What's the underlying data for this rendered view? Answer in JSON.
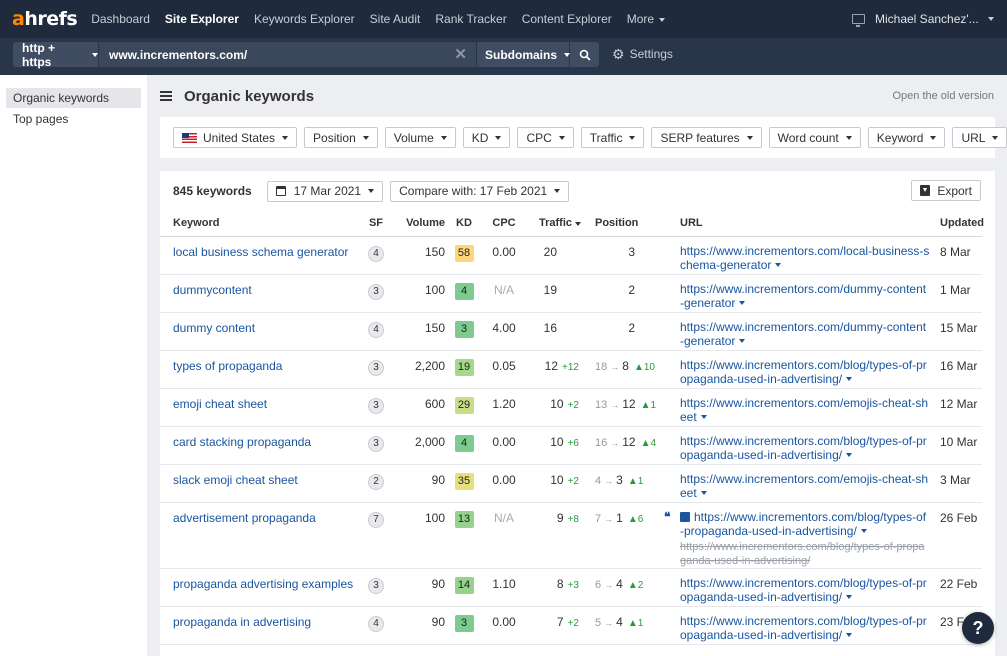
{
  "nav": {
    "logo_a": "a",
    "logo_rest": "hrefs",
    "items": [
      "Dashboard",
      "Site Explorer",
      "Keywords Explorer",
      "Site Audit",
      "Rank Tracker",
      "Content Explorer"
    ],
    "more": "More",
    "user": "Michael Sanchez'..."
  },
  "search": {
    "protocol": "http + https",
    "url": "www.incrementors.com/",
    "mode": "Subdomains",
    "settings": "Settings"
  },
  "sidebar": {
    "items": [
      "Organic keywords",
      "Top pages"
    ]
  },
  "header": {
    "title": "Organic keywords",
    "old_version": "Open the old version"
  },
  "filters": {
    "country": "United States",
    "buttons": [
      "Position",
      "Volume",
      "KD",
      "CPC",
      "Traffic",
      "SERP features",
      "Word count",
      "Keyword",
      "URL"
    ]
  },
  "summary": {
    "count": "845 keywords",
    "date": "17 Mar 2021",
    "compare": "Compare with: 17 Feb 2021",
    "export": "Export"
  },
  "table": {
    "headers": {
      "keyword": "Keyword",
      "sf": "SF",
      "volume": "Volume",
      "kd": "KD",
      "cpc": "CPC",
      "traffic": "Traffic",
      "position": "Position",
      "url": "URL",
      "updated": "Updated"
    },
    "rows": [
      {
        "keyword": "local business schema generator",
        "sf": "4",
        "volume": "150",
        "kd": "58",
        "kd_color": "#ffd77a",
        "cpc": "0.00",
        "traffic": "20",
        "traffic_delta": "",
        "pos_old": "",
        "pos": "3",
        "pos_change": "",
        "url": "https://www.incrementors.com/local-business-schema-generator",
        "url_old": "",
        "updated": "8 Mar",
        "height": 38
      },
      {
        "keyword": "dummycontent",
        "sf": "3",
        "volume": "100",
        "kd": "4",
        "kd_color": "#7ecb8f",
        "cpc": "N/A",
        "traffic": "19",
        "traffic_delta": "",
        "pos_old": "",
        "pos": "2",
        "pos_change": "",
        "url": "https://www.incrementors.com/dummy-content-generator",
        "url_old": "",
        "updated": "1 Mar",
        "height": 38
      },
      {
        "keyword": "dummy content",
        "sf": "4",
        "volume": "150",
        "kd": "3",
        "kd_color": "#7ecb8f",
        "cpc": "4.00",
        "traffic": "16",
        "traffic_delta": "",
        "pos_old": "",
        "pos": "2",
        "pos_change": "",
        "url": "https://www.incrementors.com/dummy-content-generator",
        "url_old": "",
        "updated": "15 Mar",
        "height": 38
      },
      {
        "keyword": "types of propaganda",
        "sf": "3",
        "volume": "2,200",
        "kd": "19",
        "kd_color": "#a4d98a",
        "cpc": "0.05",
        "traffic": "12",
        "traffic_delta": "+12",
        "pos_old": "18",
        "pos": "8",
        "pos_change": "▲10",
        "url": "https://www.incrementors.com/blog/types-of-propaganda-used-in-advertising/",
        "url_old": "",
        "updated": "16 Mar",
        "height": 38
      },
      {
        "keyword": "emoji cheat sheet",
        "sf": "3",
        "volume": "600",
        "kd": "29",
        "kd_color": "#c8dd86",
        "cpc": "1.20",
        "traffic": "10",
        "traffic_delta": "+2",
        "pos_old": "13",
        "pos": "12",
        "pos_change": "▲1",
        "url": "https://www.incrementors.com/emojis-cheat-sheet",
        "url_old": "",
        "updated": "12 Mar",
        "height": 38
      },
      {
        "keyword": "card stacking propaganda",
        "sf": "3",
        "volume": "2,000",
        "kd": "4",
        "kd_color": "#7ecb8f",
        "cpc": "0.00",
        "traffic": "10",
        "traffic_delta": "+6",
        "pos_old": "16",
        "pos": "12",
        "pos_change": "▲4",
        "url": "https://www.incrementors.com/blog/types-of-propaganda-used-in-advertising/",
        "url_old": "",
        "updated": "10 Mar",
        "height": 38
      },
      {
        "keyword": "slack emoji cheat sheet",
        "sf": "2",
        "volume": "90",
        "kd": "35",
        "kd_color": "#e6df7c",
        "cpc": "0.00",
        "traffic": "10",
        "traffic_delta": "+2",
        "pos_old": "4",
        "pos": "3",
        "pos_change": "▲1",
        "url": "https://www.incrementors.com/emojis-cheat-sheet",
        "url_old": "",
        "updated": "3 Mar",
        "height": 38
      },
      {
        "keyword": "advertisement propaganda",
        "sf": "7",
        "volume": "100",
        "kd": "13",
        "kd_color": "#94d38d",
        "cpc": "N/A",
        "traffic": "9",
        "traffic_delta": "+8",
        "pos_old": "7",
        "pos": "1",
        "pos_change": "▲6",
        "url": "https://www.incrementors.com/blog/types-of-propaganda-used-in-advertising/",
        "url_old": "https://www.incrementors.com/blog/types-of-propaganda-used-in-advertising/",
        "updated": "26 Feb",
        "height": 66,
        "featured": true
      },
      {
        "keyword": "propaganda advertising examples",
        "sf": "3",
        "volume": "90",
        "kd": "14",
        "kd_color": "#94d38d",
        "cpc": "1.10",
        "traffic": "8",
        "traffic_delta": "+3",
        "pos_old": "6",
        "pos": "4",
        "pos_change": "▲2",
        "url": "https://www.incrementors.com/blog/types-of-propaganda-used-in-advertising/",
        "url_old": "",
        "updated": "22 Feb",
        "height": 38
      },
      {
        "keyword": "propaganda in advertising",
        "sf": "4",
        "volume": "90",
        "kd": "3",
        "kd_color": "#7ecb8f",
        "cpc": "0.00",
        "traffic": "7",
        "traffic_delta": "+2",
        "pos_old": "5",
        "pos": "4",
        "pos_change": "▲1",
        "url": "https://www.incrementors.com/blog/types-of-propaganda-used-in-advertising/",
        "url_old": "",
        "updated": "23 Feb",
        "height": 38
      }
    ]
  },
  "help": "?"
}
